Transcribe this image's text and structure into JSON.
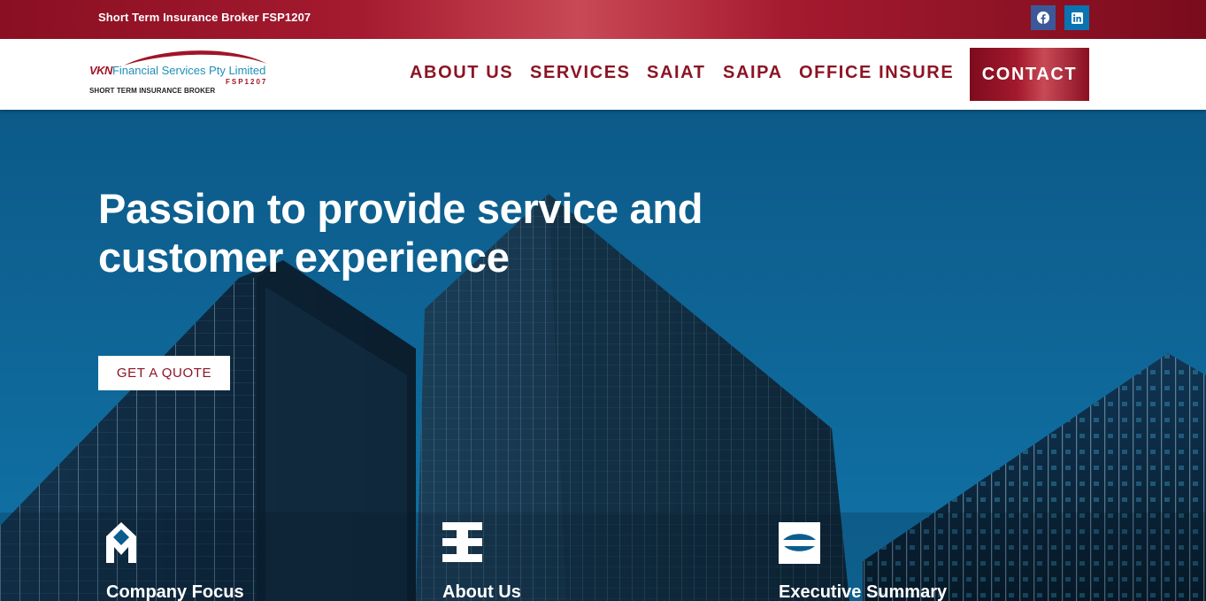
{
  "topbar": {
    "tagline": "Short Term Insurance Broker FSP1207",
    "social": [
      {
        "icon": "facebook-icon",
        "color": "#3b5998"
      },
      {
        "icon": "linkedin-icon",
        "color": "#0a73b1"
      }
    ]
  },
  "logo": {
    "brand": "VKN",
    "name": "Financial Services Pty Limited",
    "fsp": "FSP1207",
    "tagline": "SHORT TERM INSURANCE BROKER"
  },
  "nav": {
    "items": [
      "ABOUT US",
      "SERVICES",
      "SAIAT",
      "SAIPA",
      "OFFICE INSURE"
    ],
    "contact": "CONTACT"
  },
  "hero": {
    "title_line1": "Passion to provide service and",
    "title_line2": "customer experience",
    "cta": "GET A QUOTE"
  },
  "features": [
    {
      "title": "Company Focus",
      "icon": "company-focus-icon"
    },
    {
      "title": "About Us",
      "icon": "about-us-icon"
    },
    {
      "title": "Executive Summary",
      "icon": "executive-summary-icon"
    }
  ],
  "colors": {
    "brand_red": "#8c1424",
    "hero_blue": "#0b5d8e",
    "white": "#ffffff"
  }
}
